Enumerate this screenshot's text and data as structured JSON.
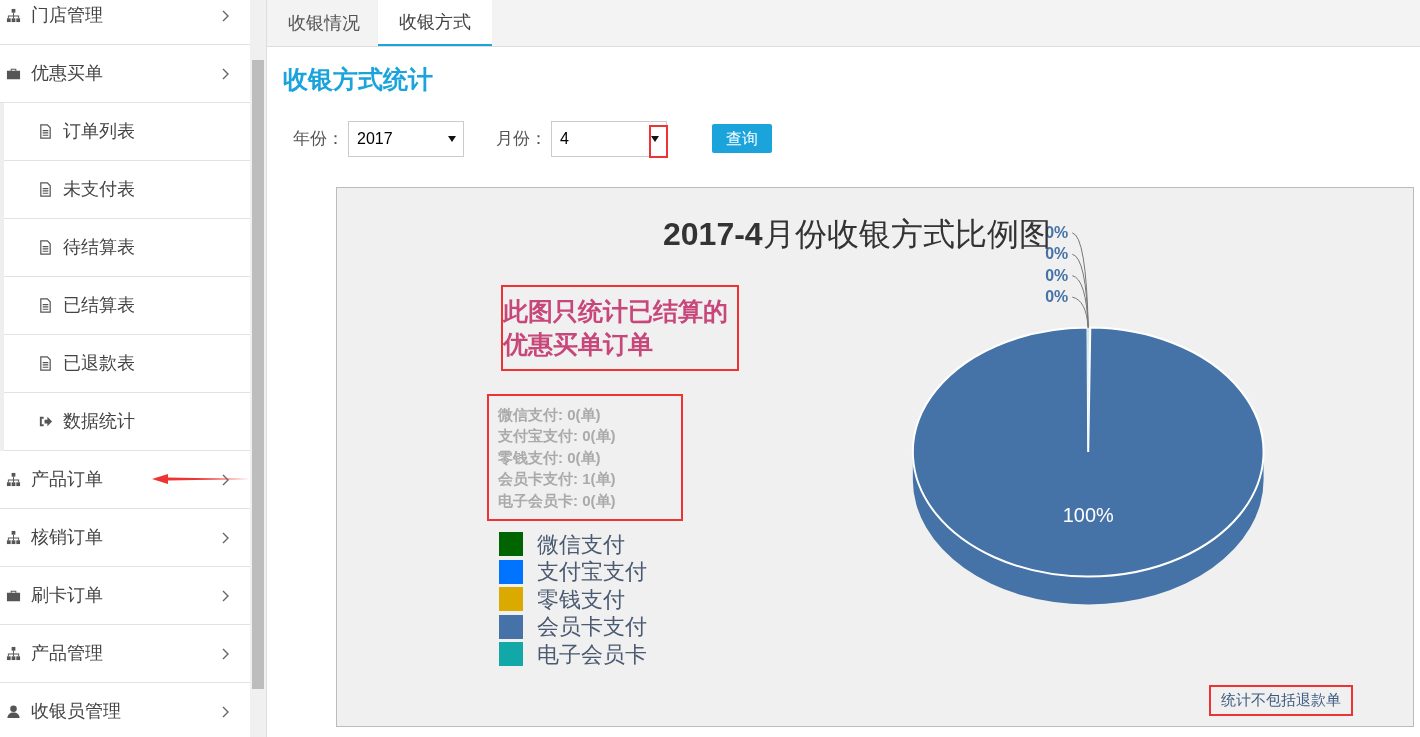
{
  "sidebar": {
    "items": [
      {
        "label": "门店管理"
      },
      {
        "label": "优惠买单",
        "children": [
          {
            "label": "订单列表"
          },
          {
            "label": "未支付表"
          },
          {
            "label": "待结算表"
          },
          {
            "label": "已结算表"
          },
          {
            "label": "已退款表"
          },
          {
            "label": "数据统计"
          }
        ]
      },
      {
        "label": "产品订单"
      },
      {
        "label": "核销订单"
      },
      {
        "label": "刷卡订单"
      },
      {
        "label": "产品管理"
      },
      {
        "label": "收银员管理"
      }
    ]
  },
  "tabs": [
    {
      "label": "收银情况",
      "selected": false
    },
    {
      "label": "收银方式",
      "selected": true
    }
  ],
  "heading": "收银方式统计",
  "filters": [
    {
      "label": "年份：",
      "value": "2017"
    },
    {
      "label": "月份：",
      "value": "4"
    }
  ],
  "query_button": "查询",
  "chart_panel": {
    "note": "此图只统计已结算的优惠买单订单",
    "stats": [
      "微信支付: 0(单)",
      "支付宝支付: 0(单)",
      "零钱支付: 0(单)",
      "会员卡支付: 1(单)",
      "电子会员卡: 0(单)"
    ],
    "footnote": "统计不包括退款单",
    "chart_data": {
      "type": "pie",
      "title": "**2017-4**月份收银方式比例图",
      "categories": [
        "微信支付",
        "支付宝支付",
        "零钱支付",
        "会员卡支付",
        "电子会员卡"
      ],
      "values": [
        0,
        0,
        0,
        1,
        0
      ],
      "colors": [
        "#006400",
        "#0073ff",
        "#dbaa00",
        "#4572a7",
        "#13a8a8"
      ],
      "value_labels": [
        "0%",
        "0%",
        "0%",
        "100%",
        "0%"
      ]
    }
  }
}
